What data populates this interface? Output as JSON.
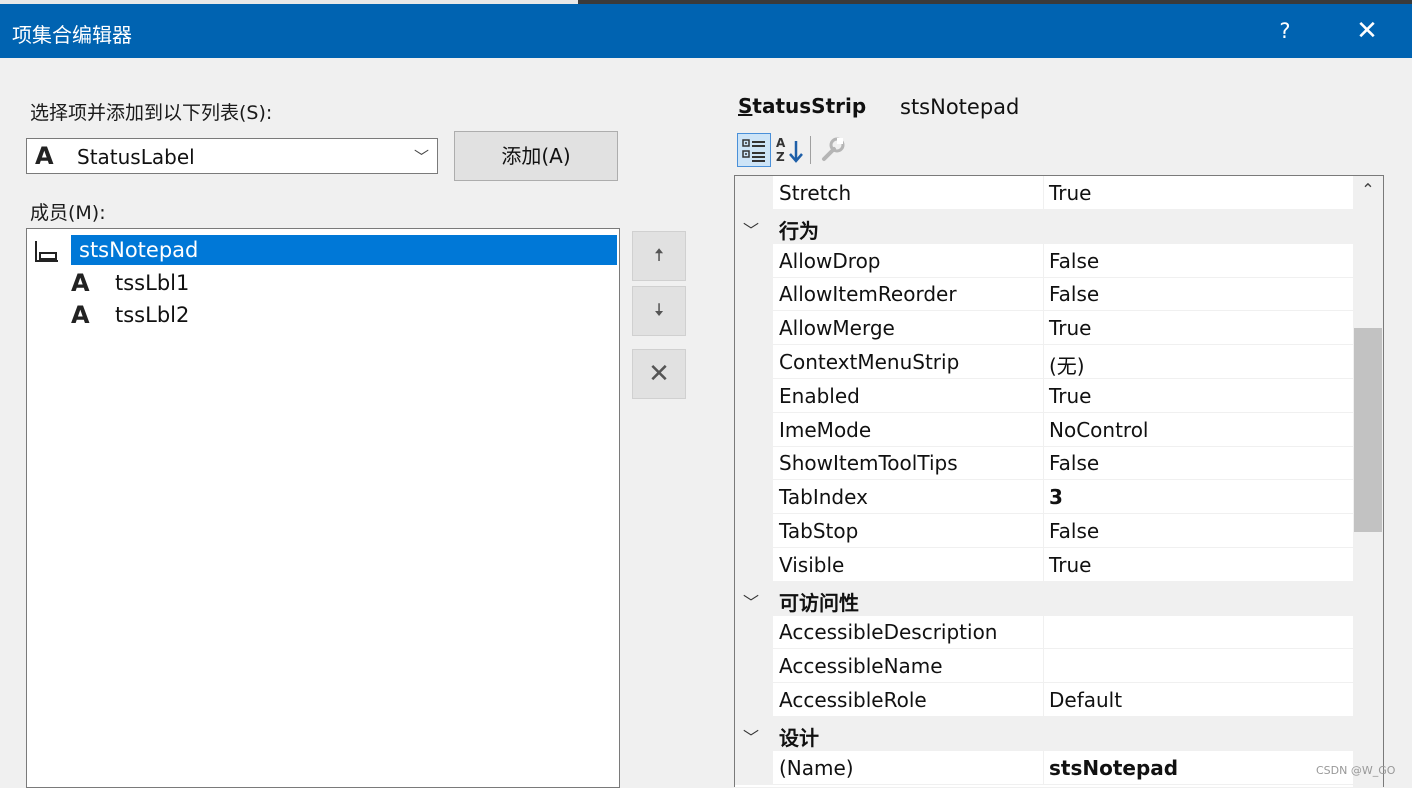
{
  "window": {
    "title": "项集合编辑器",
    "help_label": "?",
    "close_label": "✕"
  },
  "left": {
    "select_label": "选择项并添加到以下列表(S):",
    "item_type": {
      "icon_glyph": "A",
      "value": "StatusLabel",
      "chevron": "﹀"
    },
    "add_button": "添加(A)",
    "members_label": "成员(M):",
    "tree": {
      "root": {
        "label": "stsNotepad"
      },
      "children": [
        {
          "icon_glyph": "A",
          "label": "tssLbl1"
        },
        {
          "icon_glyph": "A",
          "label": "tssLbl2"
        }
      ]
    }
  },
  "side_buttons": {
    "up_glyph": "🠅",
    "down_glyph": "🠇",
    "delete_glyph": "✕"
  },
  "right": {
    "component_type": "StatusStrip",
    "component_type_underlined": "S",
    "component_type_rest": "tatusStrip",
    "component_name": "stsNotepad",
    "grid": {
      "scroll_up_glyph": "⌃",
      "rows": [
        {
          "kind": "prop",
          "name": "Stretch",
          "value": "True"
        },
        {
          "kind": "cat",
          "name": "行为"
        },
        {
          "kind": "prop",
          "name": "AllowDrop",
          "value": "False"
        },
        {
          "kind": "prop",
          "name": "AllowItemReorder",
          "value": "False"
        },
        {
          "kind": "prop",
          "name": "AllowMerge",
          "value": "True"
        },
        {
          "kind": "prop",
          "name": "ContextMenuStrip",
          "value": "(无)"
        },
        {
          "kind": "prop",
          "name": "Enabled",
          "value": "True"
        },
        {
          "kind": "prop",
          "name": "ImeMode",
          "value": "NoControl"
        },
        {
          "kind": "prop",
          "name": "ShowItemToolTips",
          "value": "False"
        },
        {
          "kind": "prop",
          "name": "TabIndex",
          "value": "3",
          "bold": true
        },
        {
          "kind": "prop",
          "name": "TabStop",
          "value": "False"
        },
        {
          "kind": "prop",
          "name": "Visible",
          "value": "True"
        },
        {
          "kind": "cat",
          "name": "可访问性"
        },
        {
          "kind": "prop",
          "name": "AccessibleDescription",
          "value": ""
        },
        {
          "kind": "prop",
          "name": "AccessibleName",
          "value": ""
        },
        {
          "kind": "prop",
          "name": "AccessibleRole",
          "value": "Default"
        },
        {
          "kind": "cat",
          "name": "设计"
        },
        {
          "kind": "prop",
          "name": "(Name)",
          "value": "stsNotepad",
          "bold": true
        }
      ]
    }
  },
  "watermark": "CSDN @W_GO",
  "colors": {
    "titlebar": "#0063b1",
    "selection": "#0078d7"
  }
}
